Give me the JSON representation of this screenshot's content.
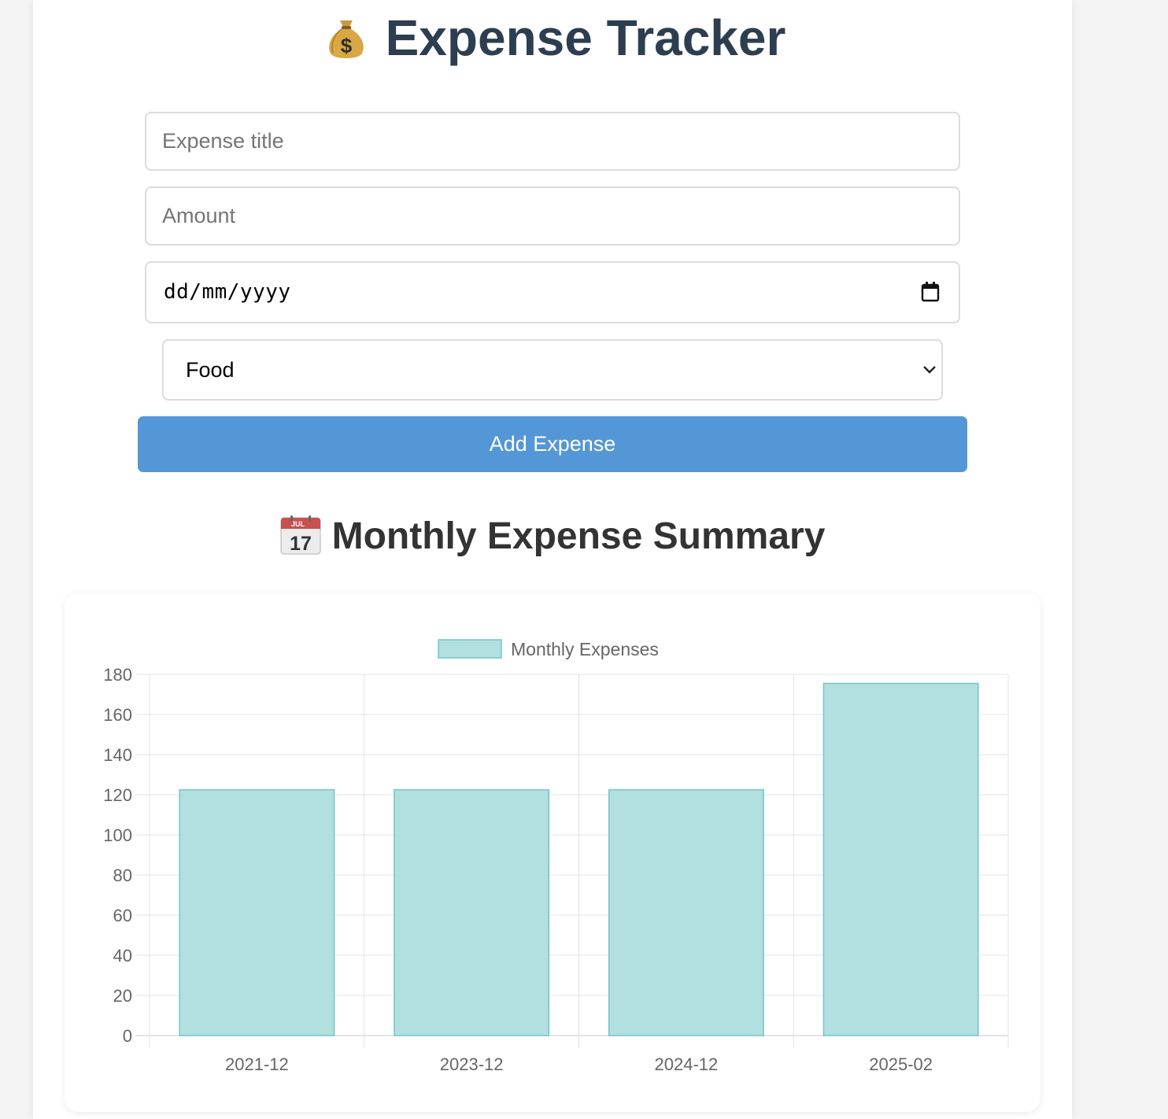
{
  "app": {
    "title": "Expense Tracker",
    "title_icon": "money-bag-icon"
  },
  "form": {
    "title_placeholder": "Expense title",
    "amount_placeholder": "Amount",
    "date_placeholder": "dd/mm/yyyy",
    "category_selected": "Food",
    "add_button_label": "Add Expense",
    "colors": {
      "button": "#5497d6",
      "border": "#dcdcdc"
    }
  },
  "summary": {
    "title": "Monthly Expense Summary",
    "title_icon": "calendar-icon"
  },
  "chart_data": {
    "type": "bar",
    "categories": [
      "2021-12",
      "2023-12",
      "2024-12",
      "2025-02"
    ],
    "series": [
      {
        "name": "Monthly Expenses",
        "values": [
          122.5,
          122.5,
          122.5,
          175.5
        ]
      }
    ],
    "ylim": [
      0,
      180
    ],
    "yticks": [
      0,
      20,
      40,
      60,
      80,
      100,
      120,
      140,
      160,
      180
    ],
    "grid": true,
    "legend": "top-center",
    "colors": {
      "fill": "#b2dfe0",
      "stroke": "#74c6c5"
    }
  }
}
